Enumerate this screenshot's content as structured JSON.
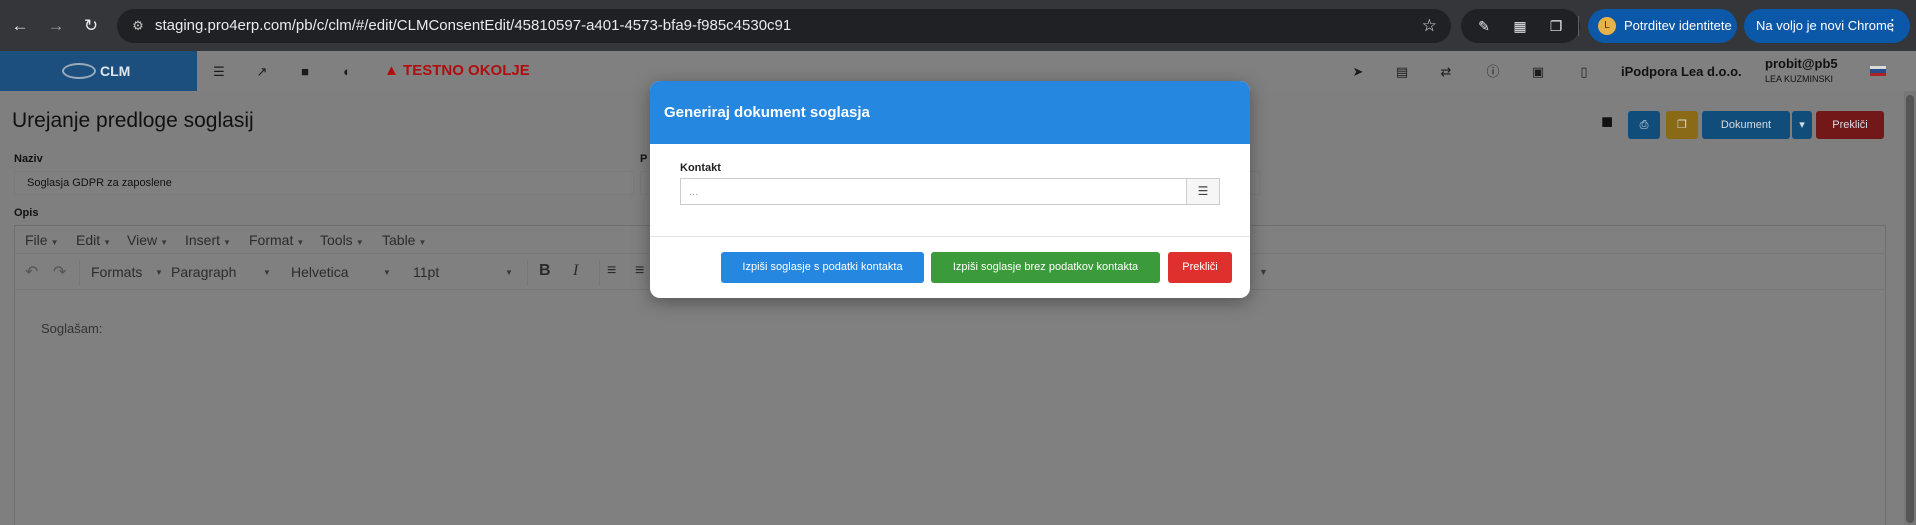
{
  "browser": {
    "url": "staging.pro4erp.com/pb/c/clm/#/edit/CLMConsentEdit/45810597-a401-4573-bfa9-f985c4530c91",
    "identity_button": "Potrditev identitete",
    "update_button": "Na voljo je novi Chrome"
  },
  "app": {
    "brand": "CLM",
    "test_env_label": "TESTNO OKOLJE",
    "company": "iPodpora Lea d.o.o.",
    "user": "probit@pb5",
    "user_name": "LEA KUZMINSKI",
    "page_title": "Urejanje predloge soglasij",
    "actions": {
      "document": "Dokument",
      "cancel": "Prekliči"
    },
    "fields": {
      "name_label": "Naziv",
      "name_value": "Soglasja GDPR za zaposlene",
      "second_label_fragment": "P",
      "description_label": "Opis"
    },
    "editor": {
      "menu": [
        "File",
        "Edit",
        "View",
        "Insert",
        "Format",
        "Tools",
        "Table"
      ],
      "formats": "Formats",
      "block": "Paragraph",
      "font": "Helvetica",
      "size": "11pt",
      "content": "Soglašam:"
    }
  },
  "modal": {
    "title": "Generiraj dokument soglasja",
    "contact_label": "Kontakt",
    "contact_placeholder": "...",
    "buttons": {
      "with_contact": "Izpiši soglasje s podatki kontakta",
      "without_contact": "Izpiši soglasje brez podatkov kontakta",
      "cancel": "Prekliči"
    }
  },
  "colors": {
    "modal_header": "#2587df",
    "primary": "#2587df",
    "success": "#3b9b3b",
    "danger": "#e0302d",
    "test_env": "#b10d0d"
  }
}
